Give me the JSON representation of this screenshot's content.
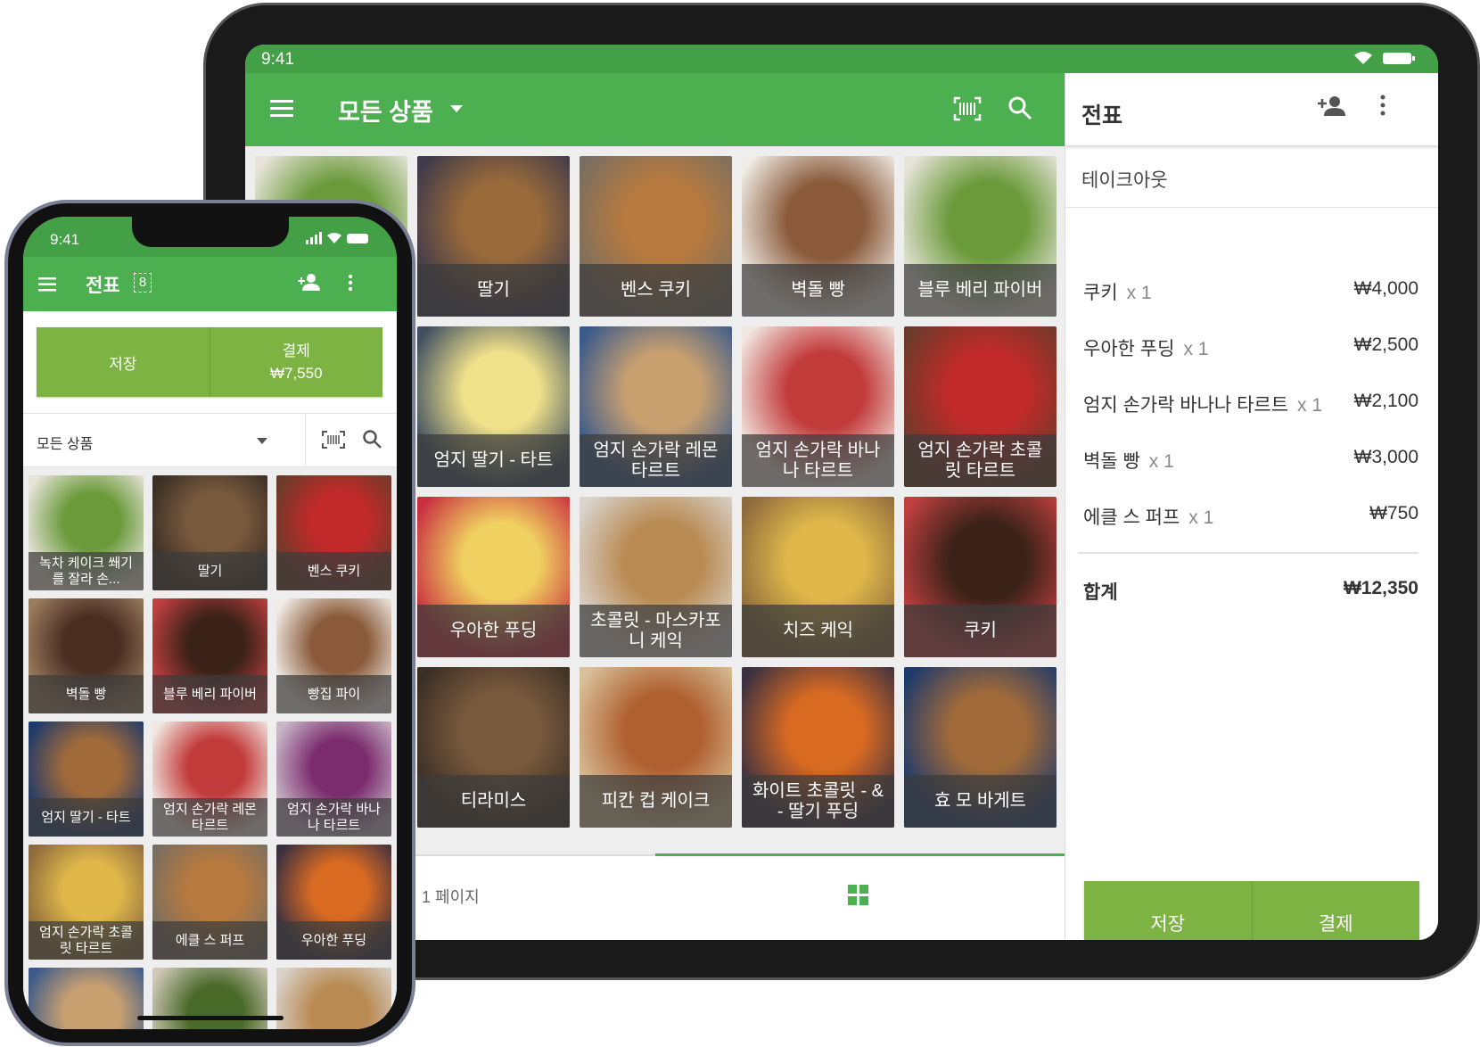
{
  "colors": {
    "green": "#4caf50",
    "status_green": "#43a047",
    "button_green": "#7cb342"
  },
  "tablet": {
    "status_time": "9:41",
    "toolbar": {
      "title": "모든 상품",
      "icons": [
        "menu-icon",
        "dropdown-icon",
        "barcode-icon",
        "search-icon"
      ]
    },
    "tiles": [
      {
        "label": ""
      },
      {
        "label": "딸기"
      },
      {
        "label": "벤스 쿠키"
      },
      {
        "label": "벽돌 빵"
      },
      {
        "label": "블루 베리 파이버"
      },
      {
        "label": ""
      },
      {
        "label": "엄지 딸기 - 타트"
      },
      {
        "label": "엄지 손가락 레몬 타르트"
      },
      {
        "label": "엄지 손가락 바나나 타르트"
      },
      {
        "label": "엄지 손가락 초콜릿 타르트"
      },
      {
        "label": ""
      },
      {
        "label": "우아한 푸딩"
      },
      {
        "label": "초콜릿 - 마스카포니 케익"
      },
      {
        "label": "치즈 케익"
      },
      {
        "label": "쿠키"
      },
      {
        "label": ""
      },
      {
        "label": "티라미스"
      },
      {
        "label": "피칸 컵 케이크"
      },
      {
        "label": "화이트 초콜릿 - & - 딸기 푸딩"
      },
      {
        "label": "효 모 바게트"
      }
    ],
    "footer": {
      "page": "1 페이지"
    },
    "receipt": {
      "title": "전표",
      "dining": "테이크아웃",
      "items": [
        {
          "name": "쿠키",
          "qty": "x 1",
          "price": "₩4,000"
        },
        {
          "name": "우아한 푸딩",
          "qty": "x 1",
          "price": "₩2,500"
        },
        {
          "name": "엄지 손가락 바나나 타르트",
          "qty": "x 1",
          "price": "₩2,100"
        },
        {
          "name": "벽돌 빵",
          "qty": "x 1",
          "price": "₩3,000"
        },
        {
          "name": "에클 스 퍼프",
          "qty": "x 1",
          "price": "₩750"
        }
      ],
      "total_label": "합계",
      "total": "₩12,350",
      "save": "저장",
      "charge": "결제"
    }
  },
  "phone": {
    "status_time": "9:41",
    "title": "전표",
    "ticket_count": "8",
    "save": "저장",
    "charge": "결제",
    "charge_amount": "₩7,550",
    "filter": "모든 상품",
    "tiles": [
      {
        "label": "녹차 케이크 쐐기를 잘라 손..."
      },
      {
        "label": "딸기"
      },
      {
        "label": "벤스 쿠키"
      },
      {
        "label": "벽돌 빵"
      },
      {
        "label": "블루 베리 파이버"
      },
      {
        "label": "빵집 파이"
      },
      {
        "label": "엄지 딸기 - 타트"
      },
      {
        "label": "엄지 손가락 레몬 타르트"
      },
      {
        "label": "엄지 손가락 바나나 타르트"
      },
      {
        "label": "엄지 손가락 초콜릿 타르트"
      },
      {
        "label": "에클 스 퍼프"
      },
      {
        "label": "우아한 푸딩"
      },
      {
        "label": ""
      },
      {
        "label": ""
      },
      {
        "label": ""
      }
    ]
  }
}
